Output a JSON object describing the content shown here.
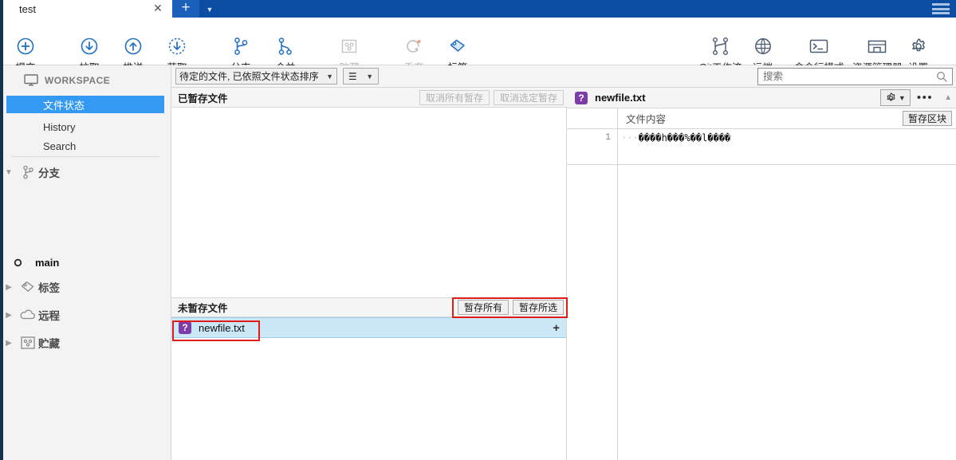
{
  "titlebar": {
    "tab_label": "test",
    "close_icon": "close-icon",
    "new_tab_icon": "plus-icon",
    "tab_dropdown_icon": "chevron-down-icon",
    "menu_icon": "hamburger-menu-icon"
  },
  "toolbar": {
    "left_buttons": [
      {
        "label": "提交",
        "icon": "commit-plus-circle-icon",
        "disabled": false
      },
      {
        "label": "拉取",
        "icon": "pull-down-arrow-circle-icon",
        "disabled": false
      },
      {
        "label": "推送",
        "icon": "push-up-arrow-circle-icon",
        "disabled": false
      },
      {
        "label": "获取",
        "icon": "fetch-dashed-circle-icon",
        "disabled": false
      },
      {
        "label": "分支",
        "icon": "branch-icon",
        "disabled": false
      },
      {
        "label": "合并",
        "icon": "merge-icon",
        "disabled": false
      },
      {
        "label": "贮藏",
        "icon": "stash-box-icon",
        "disabled": true
      },
      {
        "label": "丢弃",
        "icon": "discard-refresh-icon",
        "disabled": true
      },
      {
        "label": "标签",
        "icon": "tag-icon",
        "disabled": false
      }
    ],
    "right_buttons": [
      {
        "label": "Git工作流",
        "icon": "gitflow-icon"
      },
      {
        "label": "远端",
        "icon": "globe-remote-icon"
      },
      {
        "label": "命令行模式",
        "icon": "terminal-icon"
      },
      {
        "label": "资源管理器",
        "icon": "explorer-folder-icon"
      },
      {
        "label": "设置",
        "icon": "gear-settings-icon"
      }
    ]
  },
  "sidebar": {
    "workspace_label": "WORKSPACE",
    "workspace_icon": "monitor-icon",
    "items": [
      {
        "label": "文件状态",
        "selected": true
      },
      {
        "label": "History",
        "selected": false
      },
      {
        "label": "Search",
        "selected": false
      }
    ],
    "groups": [
      {
        "label": "分支",
        "icon": "branch-icon",
        "expanded": true,
        "caret": "chevron-down-icon"
      },
      {
        "label": "标签",
        "icon": "tag-icon",
        "expanded": false,
        "caret": "chevron-right-icon"
      },
      {
        "label": "远程",
        "icon": "cloud-icon",
        "expanded": false,
        "caret": "chevron-right-icon"
      },
      {
        "label": "贮藏",
        "icon": "stash-box-icon",
        "expanded": false,
        "caret": "chevron-right-icon"
      }
    ],
    "branch": {
      "name": "main",
      "icon": "branch-dot-icon"
    }
  },
  "filterbar": {
    "filter_value": "待定的文件, 已依照文件状态排序",
    "filter_caret": "chevron-down-icon",
    "menu_icon": "list-lines-icon",
    "menu_caret": "chevron-down-icon"
  },
  "search": {
    "placeholder": "搜索",
    "value": "",
    "icon": "search-icon"
  },
  "staged": {
    "title": "已暂存文件",
    "buttons": [
      {
        "label": "取消所有暂存",
        "disabled": true
      },
      {
        "label": "取消选定暂存",
        "disabled": true
      }
    ],
    "files": []
  },
  "unstaged": {
    "title": "未暂存文件",
    "buttons": [
      {
        "label": "暂存所有",
        "disabled": false
      },
      {
        "label": "暂存所选",
        "disabled": false
      }
    ],
    "files": [
      {
        "name": "newfile.txt",
        "status_badge": "?",
        "badge_color": "#7e3ca8",
        "selected": true,
        "add_icon": "plus-icon"
      }
    ]
  },
  "diff": {
    "file_name": "newfile.txt",
    "status_badge": "?",
    "gear_icon": "gear-icon",
    "gear_caret": "chevron-down-icon",
    "more_icon": "ellipsis-icon",
    "scroll_icon": "chevron-up-icon",
    "content_header": "文件内容",
    "stage_hunk_label": "暂存区块",
    "lines": [
      {
        "number": "1",
        "leading": "···",
        "text": "����h���%��l����"
      }
    ]
  },
  "annotations": [
    {
      "name": "stage-buttons-highlight"
    },
    {
      "name": "unstaged-file-highlight"
    }
  ],
  "colors": {
    "titlebar": "#0b4da2",
    "accent_selected": "#3399f3",
    "row_selected": "#cce8f7",
    "badge_purple": "#7e3ca8",
    "annotation_red": "#e01b1b",
    "icon_blue": "#1f6fc4"
  }
}
